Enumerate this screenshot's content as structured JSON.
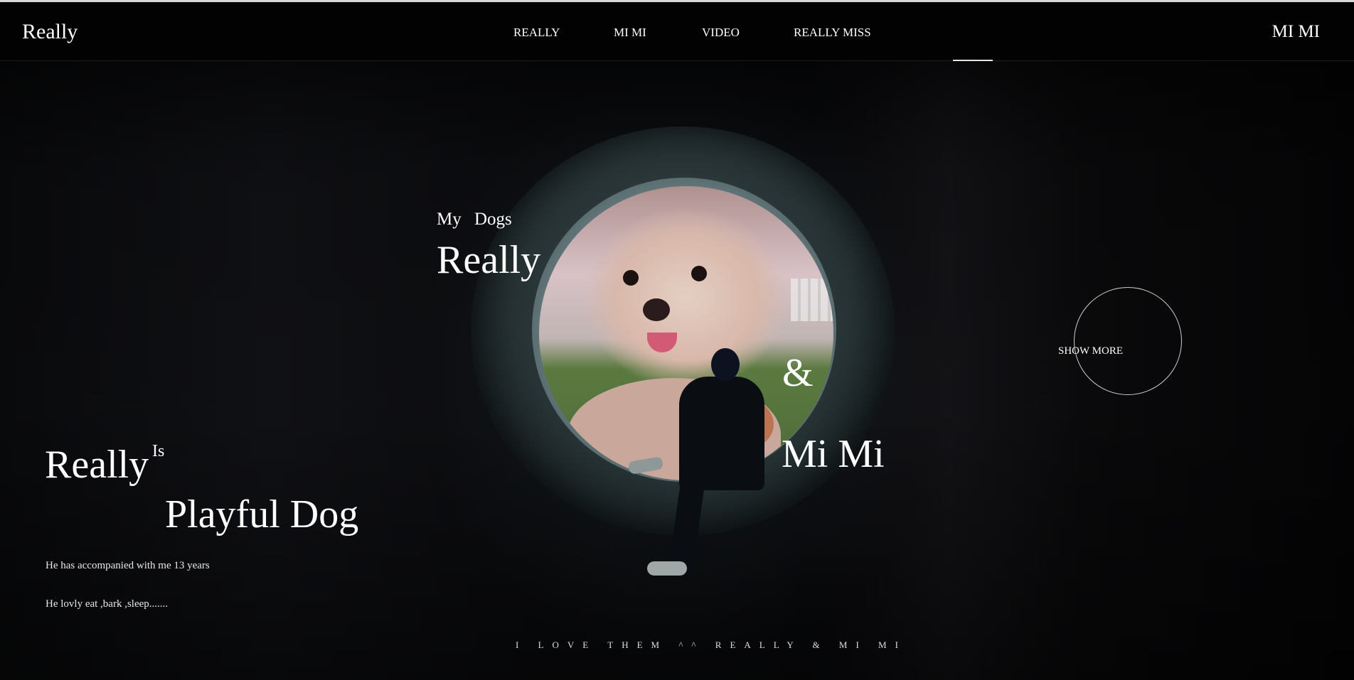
{
  "header": {
    "logo": "Really",
    "nav": [
      {
        "label": "REALLY"
      },
      {
        "label": "MI MI"
      },
      {
        "label": "VIDEO"
      },
      {
        "label": "REALLY MISS"
      }
    ],
    "right_link": "MI MI"
  },
  "hero": {
    "kicker": "My Dogs",
    "name_top": "Really",
    "ampersand": "&",
    "name_bottom": "Mi Mi",
    "show_more": "SHOW MORE"
  },
  "intro": {
    "title_word": "Really",
    "superscript": "Is",
    "subtitle": "Playful Dog",
    "line1": "He has accompanied with me 13 years",
    "line2": "He lovly eat ,bark ,sleep......."
  },
  "footer": {
    "tagline": "I LOVE THEM ^^ REALLY & MI MI"
  }
}
